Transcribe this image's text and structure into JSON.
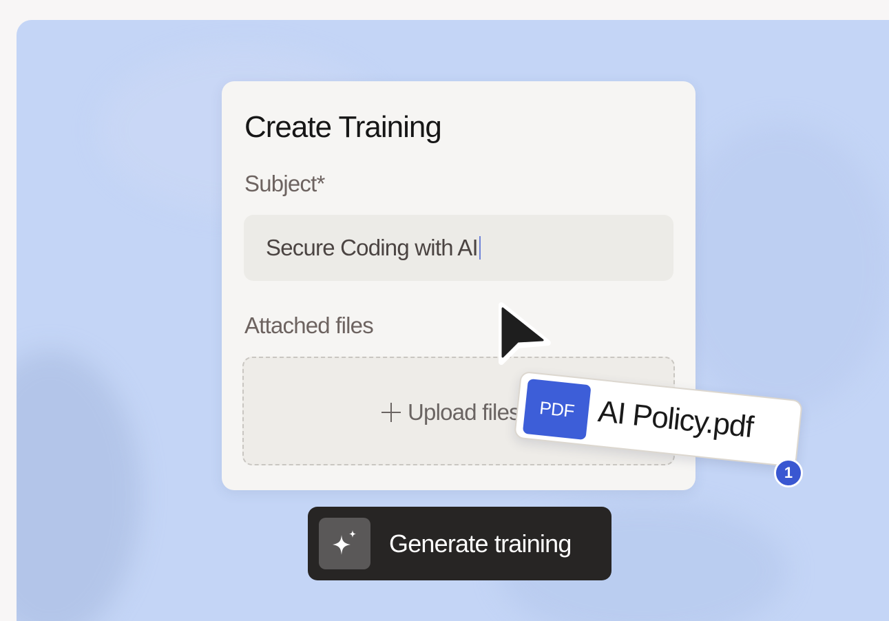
{
  "form": {
    "title": "Create Training",
    "subject_label": "Subject*",
    "subject_value": "Secure Coding with AI",
    "attached_files_label": "Attached files",
    "upload_label": "Upload files"
  },
  "dragged_file": {
    "badge": "PDF",
    "name": "AI Policy.pdf",
    "count": "1"
  },
  "action": {
    "generate_label": "Generate training",
    "icon": "sparkle-icon"
  },
  "colors": {
    "canvas": "#c4d5f6",
    "card": "#f6f5f3",
    "accent": "#3d5ed8",
    "button": "#272524"
  }
}
